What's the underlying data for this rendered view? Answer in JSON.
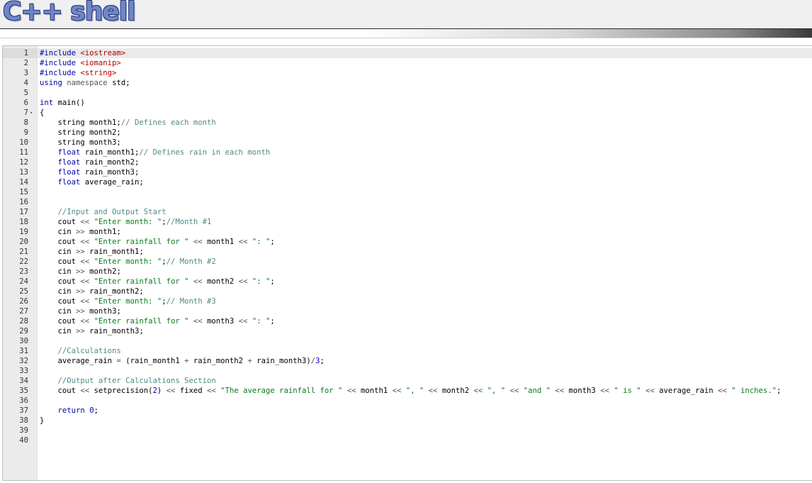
{
  "header": {
    "logo_text": "C++ shell"
  },
  "editor": {
    "active_line": 1,
    "fold_marker": "▾",
    "lines": [
      {
        "n": "1",
        "fold": false,
        "tokens": [
          [
            "kw",
            "#include "
          ],
          [
            "inc",
            "<iostream>"
          ]
        ]
      },
      {
        "n": "2",
        "fold": false,
        "tokens": [
          [
            "kw",
            "#include "
          ],
          [
            "inc",
            "<iomanip>"
          ]
        ]
      },
      {
        "n": "3",
        "fold": false,
        "tokens": [
          [
            "kw",
            "#include "
          ],
          [
            "inc",
            "<string>"
          ]
        ]
      },
      {
        "n": "4",
        "fold": false,
        "tokens": [
          [
            "kw",
            "using"
          ],
          [
            "plain",
            " "
          ],
          [
            "op",
            "namespace"
          ],
          [
            "plain",
            " std;"
          ]
        ]
      },
      {
        "n": "5",
        "fold": false,
        "tokens": []
      },
      {
        "n": "6",
        "fold": false,
        "tokens": [
          [
            "kw",
            "int"
          ],
          [
            "plain",
            " main()"
          ]
        ]
      },
      {
        "n": "7",
        "fold": true,
        "tokens": [
          [
            "plain",
            "{"
          ]
        ]
      },
      {
        "n": "8",
        "fold": false,
        "tokens": [
          [
            "plain",
            "    string month1;"
          ],
          [
            "cmt",
            "// Defines each month"
          ]
        ]
      },
      {
        "n": "9",
        "fold": false,
        "tokens": [
          [
            "plain",
            "    string month2;"
          ]
        ]
      },
      {
        "n": "10",
        "fold": false,
        "tokens": [
          [
            "plain",
            "    string month3;"
          ]
        ]
      },
      {
        "n": "11",
        "fold": false,
        "tokens": [
          [
            "plain",
            "    "
          ],
          [
            "kw",
            "float"
          ],
          [
            "plain",
            " rain_month1;"
          ],
          [
            "cmt",
            "// Defines rain in each month"
          ]
        ]
      },
      {
        "n": "12",
        "fold": false,
        "tokens": [
          [
            "plain",
            "    "
          ],
          [
            "kw",
            "float"
          ],
          [
            "plain",
            " rain_month2;"
          ]
        ]
      },
      {
        "n": "13",
        "fold": false,
        "tokens": [
          [
            "plain",
            "    "
          ],
          [
            "kw",
            "float"
          ],
          [
            "plain",
            " rain_month3;"
          ]
        ]
      },
      {
        "n": "14",
        "fold": false,
        "tokens": [
          [
            "plain",
            "    "
          ],
          [
            "kw",
            "float"
          ],
          [
            "plain",
            " average_rain;"
          ]
        ]
      },
      {
        "n": "15",
        "fold": false,
        "tokens": []
      },
      {
        "n": "16",
        "fold": false,
        "tokens": []
      },
      {
        "n": "17",
        "fold": false,
        "tokens": [
          [
            "plain",
            "    "
          ],
          [
            "cmt",
            "//Input and Output Start"
          ]
        ]
      },
      {
        "n": "18",
        "fold": false,
        "tokens": [
          [
            "plain",
            "    cout "
          ],
          [
            "op",
            "<<"
          ],
          [
            "plain",
            " "
          ],
          [
            "str",
            "\"Enter month: \""
          ],
          [
            "plain",
            ";"
          ],
          [
            "cmt",
            "//Month #1"
          ]
        ]
      },
      {
        "n": "19",
        "fold": false,
        "tokens": [
          [
            "plain",
            "    cin "
          ],
          [
            "op",
            ">>"
          ],
          [
            "plain",
            " month1;"
          ]
        ]
      },
      {
        "n": "20",
        "fold": false,
        "tokens": [
          [
            "plain",
            "    cout "
          ],
          [
            "op",
            "<<"
          ],
          [
            "plain",
            " "
          ],
          [
            "str",
            "\"Enter rainfall for \""
          ],
          [
            "plain",
            " "
          ],
          [
            "op",
            "<<"
          ],
          [
            "plain",
            " month1 "
          ],
          [
            "op",
            "<<"
          ],
          [
            "plain",
            " "
          ],
          [
            "str",
            "\": \""
          ],
          [
            "plain",
            ";"
          ]
        ]
      },
      {
        "n": "21",
        "fold": false,
        "tokens": [
          [
            "plain",
            "    cin "
          ],
          [
            "op",
            ">>"
          ],
          [
            "plain",
            " rain_month1;"
          ]
        ]
      },
      {
        "n": "22",
        "fold": false,
        "tokens": [
          [
            "plain",
            "    cout "
          ],
          [
            "op",
            "<<"
          ],
          [
            "plain",
            " "
          ],
          [
            "str",
            "\"Enter month: \""
          ],
          [
            "plain",
            ";"
          ],
          [
            "cmt",
            "// Month #2"
          ]
        ]
      },
      {
        "n": "23",
        "fold": false,
        "tokens": [
          [
            "plain",
            "    cin "
          ],
          [
            "op",
            ">>"
          ],
          [
            "plain",
            " month2;"
          ]
        ]
      },
      {
        "n": "24",
        "fold": false,
        "tokens": [
          [
            "plain",
            "    cout "
          ],
          [
            "op",
            "<<"
          ],
          [
            "plain",
            " "
          ],
          [
            "str",
            "\"Enter rainfall for \""
          ],
          [
            "plain",
            " "
          ],
          [
            "op",
            "<<"
          ],
          [
            "plain",
            " month2 "
          ],
          [
            "op",
            "<<"
          ],
          [
            "plain",
            " "
          ],
          [
            "str",
            "\": \""
          ],
          [
            "plain",
            ";"
          ]
        ]
      },
      {
        "n": "25",
        "fold": false,
        "tokens": [
          [
            "plain",
            "    cin "
          ],
          [
            "op",
            ">>"
          ],
          [
            "plain",
            " rain_month2;"
          ]
        ]
      },
      {
        "n": "26",
        "fold": false,
        "tokens": [
          [
            "plain",
            "    cout "
          ],
          [
            "op",
            "<<"
          ],
          [
            "plain",
            " "
          ],
          [
            "str",
            "\"Enter month: \""
          ],
          [
            "plain",
            ";"
          ],
          [
            "cmt",
            "// Month #3"
          ]
        ]
      },
      {
        "n": "27",
        "fold": false,
        "tokens": [
          [
            "plain",
            "    cin "
          ],
          [
            "op",
            ">>"
          ],
          [
            "plain",
            " month3;"
          ]
        ]
      },
      {
        "n": "28",
        "fold": false,
        "tokens": [
          [
            "plain",
            "    cout "
          ],
          [
            "op",
            "<<"
          ],
          [
            "plain",
            " "
          ],
          [
            "str",
            "\"Enter rainfall for \""
          ],
          [
            "plain",
            " "
          ],
          [
            "op",
            "<<"
          ],
          [
            "plain",
            " month3 "
          ],
          [
            "op",
            "<<"
          ],
          [
            "plain",
            " "
          ],
          [
            "str",
            "\": \""
          ],
          [
            "plain",
            ";"
          ]
        ]
      },
      {
        "n": "29",
        "fold": false,
        "tokens": [
          [
            "plain",
            "    cin "
          ],
          [
            "op",
            ">>"
          ],
          [
            "plain",
            " rain_month3;"
          ]
        ]
      },
      {
        "n": "30",
        "fold": false,
        "tokens": []
      },
      {
        "n": "31",
        "fold": false,
        "tokens": [
          [
            "plain",
            "    "
          ],
          [
            "cmt",
            "//Calculations"
          ]
        ]
      },
      {
        "n": "32",
        "fold": false,
        "tokens": [
          [
            "plain",
            "    average_rain "
          ],
          [
            "op",
            "="
          ],
          [
            "plain",
            " (rain_month1 "
          ],
          [
            "op",
            "+"
          ],
          [
            "plain",
            " rain_month2 "
          ],
          [
            "op",
            "+"
          ],
          [
            "plain",
            " rain_month3)"
          ],
          [
            "op",
            "/"
          ],
          [
            "num",
            "3"
          ],
          [
            "plain",
            ";"
          ]
        ]
      },
      {
        "n": "33",
        "fold": false,
        "tokens": []
      },
      {
        "n": "34",
        "fold": false,
        "tokens": [
          [
            "plain",
            "    "
          ],
          [
            "cmt",
            "//Output after Calculations Section"
          ]
        ]
      },
      {
        "n": "35",
        "fold": false,
        "tokens": [
          [
            "plain",
            "    cout "
          ],
          [
            "op",
            "<<"
          ],
          [
            "plain",
            " setprecision("
          ],
          [
            "num",
            "2"
          ],
          [
            "plain",
            ") "
          ],
          [
            "op",
            "<<"
          ],
          [
            "plain",
            " fixed "
          ],
          [
            "op",
            "<<"
          ],
          [
            "plain",
            " "
          ],
          [
            "str",
            "\"The average rainfall for \""
          ],
          [
            "plain",
            " "
          ],
          [
            "op",
            "<<"
          ],
          [
            "plain",
            " month1 "
          ],
          [
            "op",
            "<<"
          ],
          [
            "plain",
            " "
          ],
          [
            "str",
            "\", \""
          ],
          [
            "plain",
            " "
          ],
          [
            "op",
            "<<"
          ],
          [
            "plain",
            " month2 "
          ],
          [
            "op",
            "<<"
          ],
          [
            "plain",
            " "
          ],
          [
            "str",
            "\", \""
          ],
          [
            "plain",
            " "
          ],
          [
            "op",
            "<<"
          ],
          [
            "plain",
            " "
          ],
          [
            "str",
            "\"and \""
          ],
          [
            "plain",
            " "
          ],
          [
            "op",
            "<<"
          ],
          [
            "plain",
            " month3 "
          ],
          [
            "op",
            "<<"
          ],
          [
            "plain",
            " "
          ],
          [
            "str",
            "\" is \""
          ],
          [
            "plain",
            " "
          ],
          [
            "op",
            "<<"
          ],
          [
            "plain",
            " average_rain "
          ],
          [
            "op",
            "<<"
          ],
          [
            "plain",
            " "
          ],
          [
            "str",
            "\" inches.\""
          ],
          [
            "plain",
            ";"
          ]
        ]
      },
      {
        "n": "36",
        "fold": false,
        "tokens": []
      },
      {
        "n": "37",
        "fold": false,
        "tokens": [
          [
            "plain",
            "    "
          ],
          [
            "kw",
            "return"
          ],
          [
            "plain",
            " "
          ],
          [
            "num",
            "0"
          ],
          [
            "plain",
            ";"
          ]
        ]
      },
      {
        "n": "38",
        "fold": false,
        "tokens": [
          [
            "plain",
            "}"
          ]
        ]
      },
      {
        "n": "39",
        "fold": false,
        "tokens": []
      },
      {
        "n": "40",
        "fold": false,
        "tokens": []
      }
    ]
  }
}
